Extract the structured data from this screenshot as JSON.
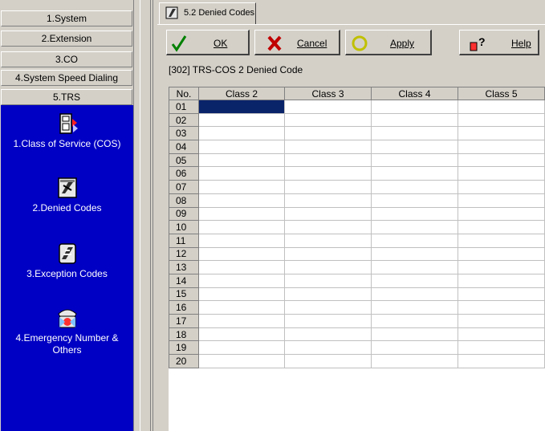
{
  "left_nav": {
    "categories": [
      {
        "label": "1.System"
      },
      {
        "label": "2.Extension"
      },
      {
        "label": "3.CO"
      },
      {
        "label": "4.System Speed Dialing"
      },
      {
        "label": "5.TRS"
      }
    ],
    "items": [
      {
        "label": "1.Class of Service (COS)",
        "icon": "class-of-service-icon"
      },
      {
        "label": "2.Denied Codes",
        "icon": "denied-codes-icon"
      },
      {
        "label": "3.Exception Codes",
        "icon": "exception-codes-icon"
      },
      {
        "label": "4.Emergency Number & Others",
        "icon": "emergency-number-icon"
      }
    ]
  },
  "tab": {
    "label": "5.2 Denied Codes",
    "icon": "denied-codes-icon"
  },
  "toolbar": {
    "ok_label": "OK",
    "cancel_label": "Cancel",
    "apply_label": "Apply",
    "help_label": "Help"
  },
  "section_title": "[302] TRS-COS 2 Denied Code",
  "table": {
    "headers": [
      "No.",
      "Class 2",
      "Class 3",
      "Class 4",
      "Class 5"
    ],
    "rows": [
      "01",
      "02",
      "03",
      "04",
      "05",
      "06",
      "07",
      "08",
      "09",
      "10",
      "11",
      "12",
      "13",
      "14",
      "15",
      "16",
      "17",
      "18",
      "19",
      "20"
    ],
    "selected_row": 0,
    "selected_column": 1
  },
  "colors": {
    "nav_panel": "#0000c4",
    "selection": "#0a246a",
    "window_face": "#d4d0c8"
  }
}
